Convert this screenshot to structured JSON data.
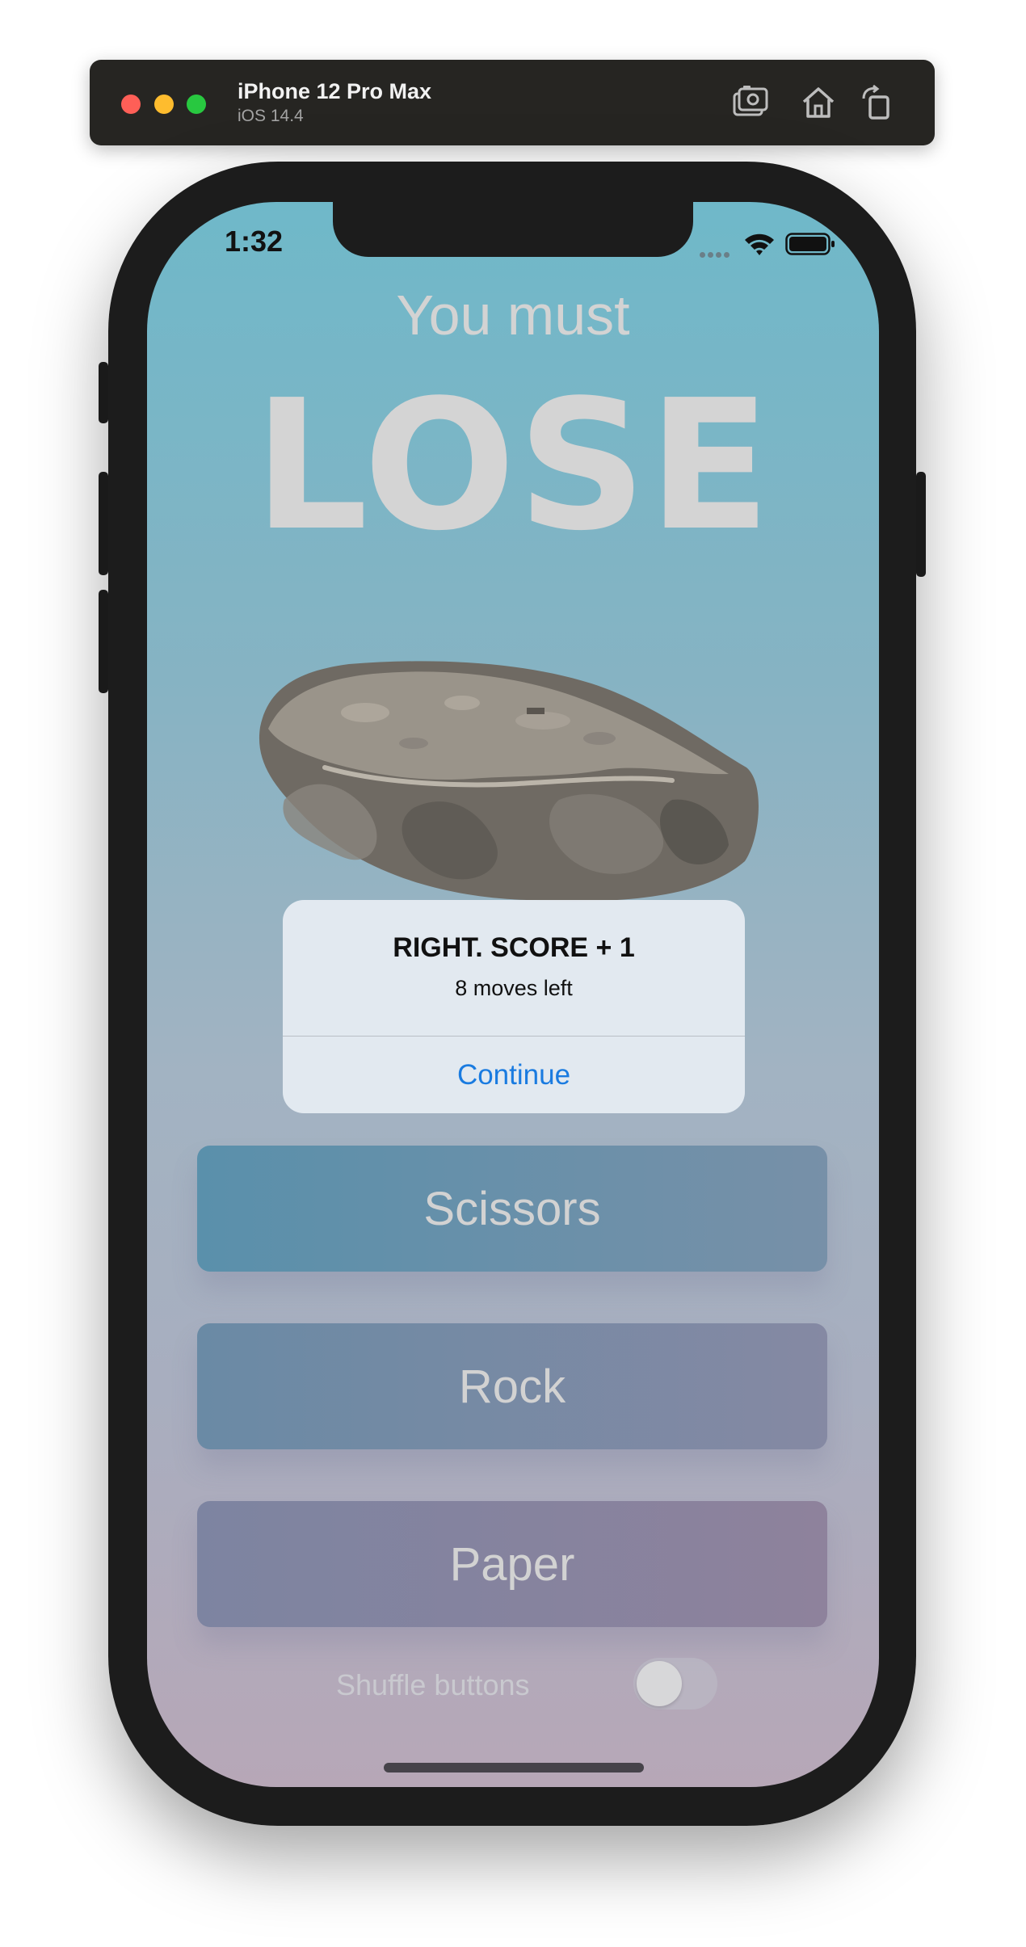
{
  "simulator": {
    "device_name": "iPhone 12 Pro Max",
    "os_version": "iOS 14.4"
  },
  "status_bar": {
    "time": "1:32"
  },
  "game": {
    "prompt": "You must",
    "target": "LOSE",
    "computer_choice_icon": "rock-illustration"
  },
  "alert": {
    "title": "RIGHT. SCORE + 1",
    "message": "8 moves left",
    "button_label": "Continue"
  },
  "moves": [
    {
      "label": "Scissors"
    },
    {
      "label": "Rock"
    },
    {
      "label": "Paper"
    }
  ],
  "shuffle": {
    "label": "Shuffle buttons",
    "enabled": false
  },
  "colors": {
    "accent": "#1a7be0",
    "screen_top": "#6fb8c9",
    "screen_bottom": "#b7a7b7"
  }
}
